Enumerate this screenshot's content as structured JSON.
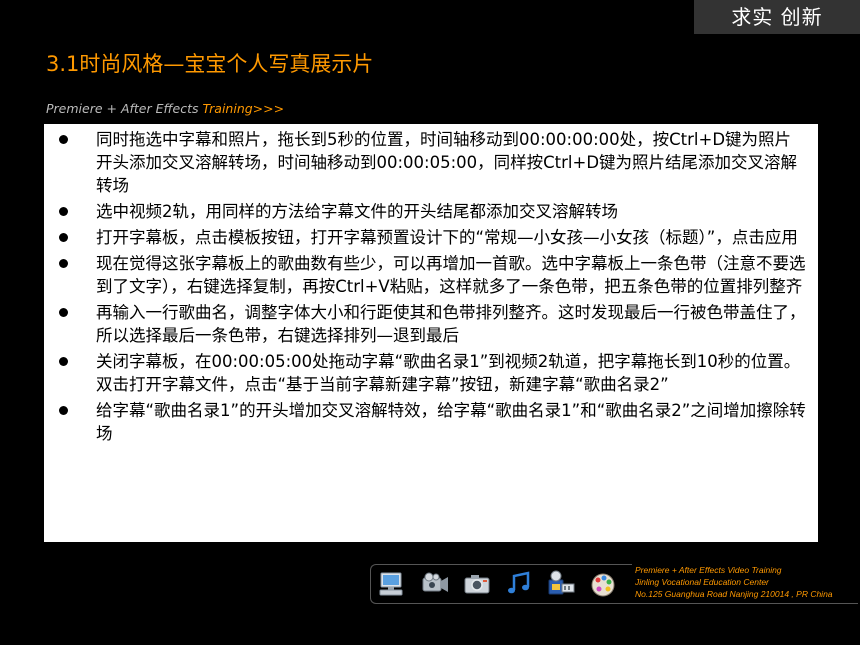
{
  "header": {
    "brand": "求实 创新",
    "title": "3.1时尚风格—宝宝个人写真展示片",
    "subtitle_prefix": "Premiere + After Effects ",
    "subtitle_suffix": "Training>>>"
  },
  "content": {
    "items": [
      "同时拖选中字幕和照片，拖长到5秒的位置，时间轴移动到00:00:00:00处，按Ctrl+D键为照片开头添加交叉溶解转场，时间轴移动到00:00:05:00，同样按Ctrl+D键为照片结尾添加交叉溶解转场",
      "选中视频2轨，用同样的方法给字幕文件的开头结尾都添加交叉溶解转场",
      "打开字幕板，点击模板按钮，打开字幕预置设计下的“常规—小女孩—小女孩（标题）”，点击应用",
      "现在觉得这张字幕板上的歌曲数有些少，可以再增加一首歌。选中字幕板上一条色带（注意不要选到了文字），右键选择复制，再按Ctrl+V粘贴，这样就多了一条色带，把五条色带的位置排列整齐",
      "再输入一行歌曲名，调整字体大小和行距使其和色带排列整齐。这时发现最后一行被色带盖住了，所以选择最后一条色带，右键选择排列—退到最后",
      "关闭字幕板，在00:00:05:00处拖动字幕“歌曲名录1”到视频2轨道，把字幕拖长到10秒的位置。双击打开字幕文件，点击“基于当前字幕新建字幕”按钮，新建字幕“歌曲名录2”",
      "给字幕“歌曲名录1”的开头增加交叉溶解特效，给字幕“歌曲名录1”和“歌曲名录2”之间增加擦除转场"
    ]
  },
  "footer": {
    "line1": "Premiere + After Effects Video Training",
    "line2": "Jinling Vocational Education Center",
    "line3": "No.125 Guanghua Road Nanjing 210014 , PR China"
  },
  "icons": [
    "computer-icon",
    "video-camera-icon",
    "photo-camera-icon",
    "music-note-icon",
    "film-reel-icon",
    "paint-palette-icon"
  ],
  "colors": {
    "accent": "#ff9900",
    "background": "#000000",
    "panel": "#ffffff"
  }
}
